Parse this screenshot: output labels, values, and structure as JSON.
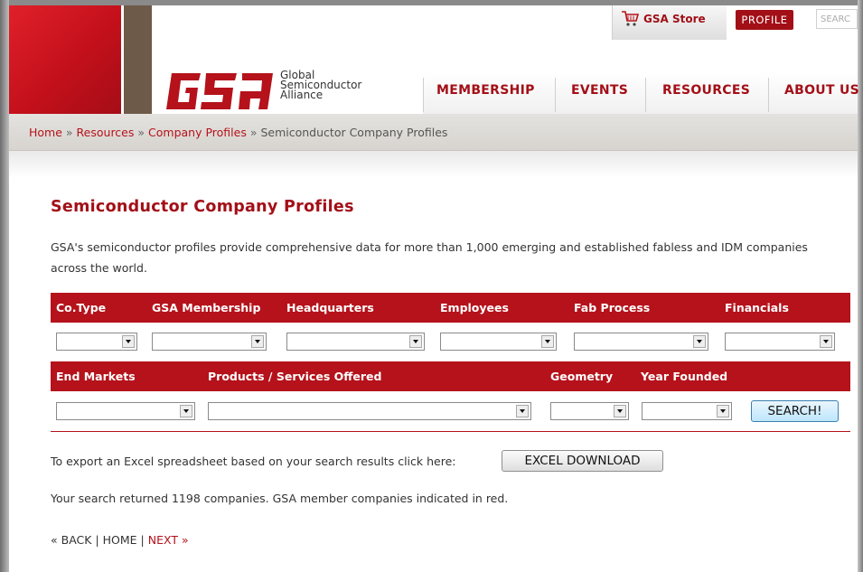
{
  "header": {
    "logo": {
      "mark": "GSA",
      "line1": "Global",
      "line2": "Semiconductor",
      "line3": "Alliance"
    },
    "store_label": "GSA Store",
    "profile_label": "PROFILE",
    "search_placeholder": "SEARC",
    "nav": [
      "MEMBERSHIP",
      "EVENTS",
      "RESOURCES",
      "ABOUT US"
    ]
  },
  "breadcrumb": {
    "items": [
      "Home",
      "Resources",
      "Company Profiles"
    ],
    "current": "Semiconductor Company Profiles",
    "separator": "»"
  },
  "page": {
    "title": "Semiconductor Company Profiles",
    "intro": "GSA's semiconductor profiles provide comprehensive data for more than 1,000 emerging and established fabless and IDM companies across the world."
  },
  "filters": {
    "row1_labels": [
      "Co.Type",
      "GSA Membership",
      "Headquarters",
      "Employees",
      "Fab Process",
      "Financials"
    ],
    "row2_labels": [
      "End Markets",
      "Products / Services Offered",
      "Geometry",
      "Year Founded"
    ],
    "search_button": "SEARCH!"
  },
  "export": {
    "text": "To export an Excel spreadsheet based on your search results click here:",
    "button": "EXCEL DOWNLOAD"
  },
  "results_text": "Your search returned 1198 companies. GSA member companies indicated in red.",
  "pager": {
    "back": "« BACK",
    "home": "HOME",
    "next": "NEXT »",
    "divider": "|"
  },
  "colors": {
    "brand_red": "#b5121b",
    "brown": "#6e5a48"
  }
}
